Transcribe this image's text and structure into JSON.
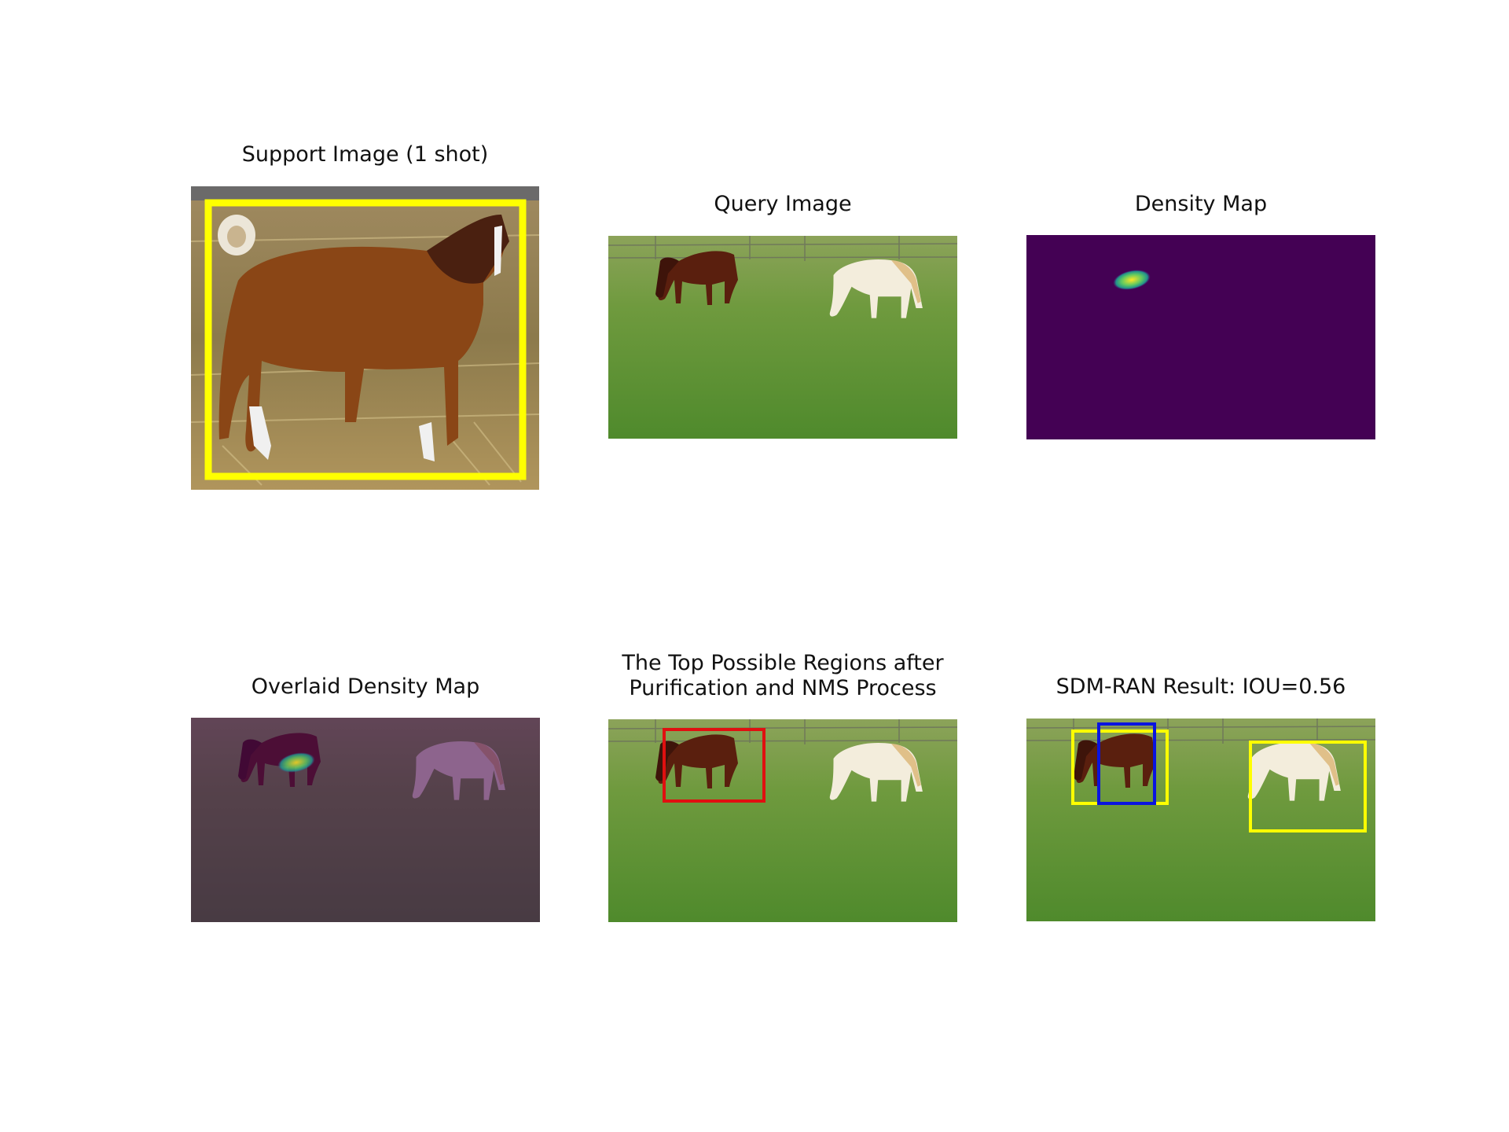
{
  "panels": {
    "support": {
      "title": "Support Image (1 shot)"
    },
    "query": {
      "title": "Query Image"
    },
    "density": {
      "title": "Density Map"
    },
    "overlaid": {
      "title": "Overlaid Density Map"
    },
    "regions": {
      "title": "The Top Possible Regions after\nPurification and NMS Process"
    },
    "result": {
      "title": "SDM-RAN Result: IOU=0.56"
    }
  },
  "colors": {
    "support_box": "#ffff00",
    "region_box": "#e01010",
    "ground_truth_box": "#ffff00",
    "predicted_box": "#0a14e0",
    "density_background": "#440154",
    "density_peak": "#fde725"
  }
}
